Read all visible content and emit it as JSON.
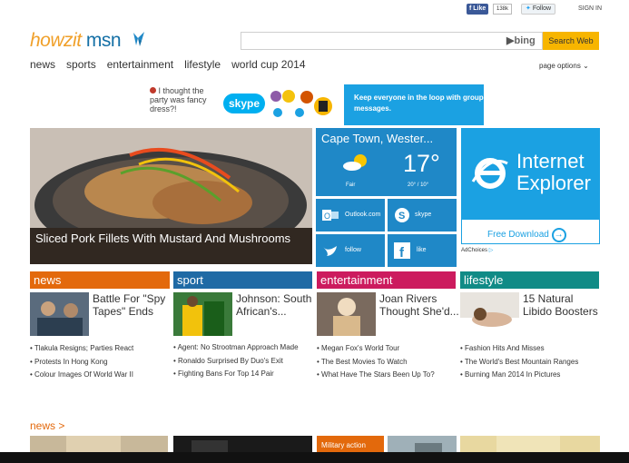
{
  "social": {
    "fb_like": "Like",
    "fb_count": "138k",
    "tw_follow": "Follow",
    "sign_in": "SIGN IN"
  },
  "brand": {
    "howzit": "howzit",
    "msn": "msn"
  },
  "search": {
    "placeholder": "",
    "bing": "bing",
    "button": "Search Web"
  },
  "nav": {
    "items": [
      "news",
      "sports",
      "entertainment",
      "lifestyle",
      "world cup 2014"
    ],
    "page_options": "page options"
  },
  "ad": {
    "chat_text": "I thought the party was fancy dress?!",
    "skype": "skype",
    "message": "Keep everyone in the loop with group messages."
  },
  "hero": {
    "caption": "Sliced Pork Fillets With Mustard And Mushrooms"
  },
  "weather": {
    "location": "Cape Town, Wester...",
    "temp": "17°",
    "condition": "Fair",
    "hilo": "20° / 10°"
  },
  "tiles": {
    "outlook": "Outlook.com",
    "skype": "skype",
    "follow": "follow",
    "like": "like"
  },
  "ie_ad": {
    "title_line1": "Internet",
    "title_line2": "Explorer",
    "download": "Free Download",
    "adchoices": "AdChoices"
  },
  "sections": {
    "news": {
      "title": "news",
      "story": "Battle For \"Spy Tapes\" Ends",
      "bullets": [
        "Tlakula Resigns; Parties React",
        "Protests In Hong Kong",
        "Colour Images Of World War II"
      ]
    },
    "sport": {
      "title": "sport",
      "story": "Johnson: South African's...",
      "bullets": [
        "Agent: No Strootman Approach Made",
        "Ronaldo Surprised By Duo's Exit",
        "Fighting Bans For Top 14 Pair"
      ]
    },
    "entertainment": {
      "title": "entertainment",
      "story": "Joan Rivers Thought She'd...",
      "bullets": [
        "Megan Fox's World Tour",
        "The Best Movies To Watch",
        "What Have The Stars Been Up To?"
      ]
    },
    "lifestyle": {
      "title": "lifestyle",
      "story": "15 Natural Libido Boosters",
      "bullets": [
        "Fashion Hits And Misses",
        "The World's Best Mountain Ranges",
        "Burning Man 2014 In Pictures"
      ]
    }
  },
  "news_more": {
    "label": "news >",
    "military": "Military action"
  }
}
